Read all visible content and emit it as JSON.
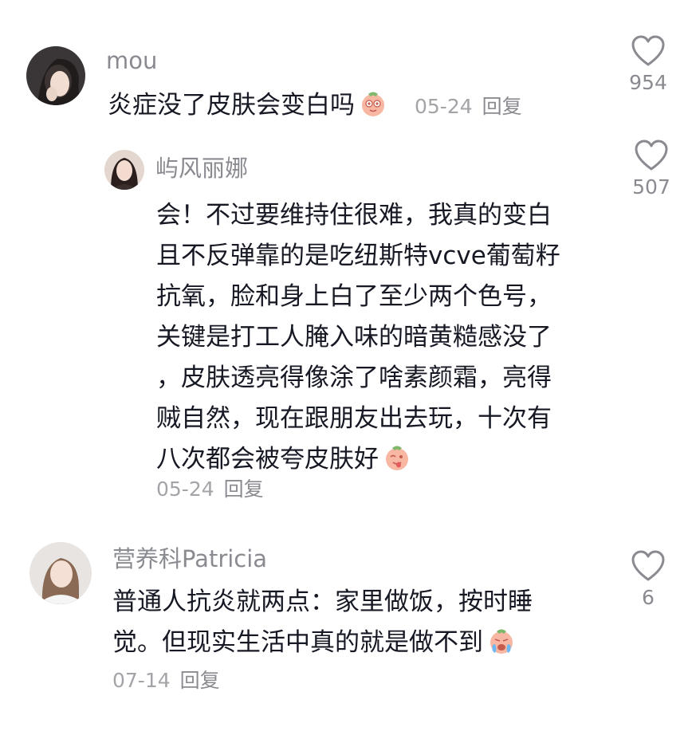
{
  "comments": [
    {
      "username": "mou",
      "text": "炎症没了皮肤会变白吗",
      "emoji": "doge-face-icon",
      "date": "05-24",
      "reply_label": "回复",
      "likes": "954",
      "replies": [
        {
          "username": "屿风丽娜",
          "text_lines": [
            "会！不过要维持住很难，我真的变白",
            "且不反弹靠的是吃纽斯特vcve葡萄籽",
            "抗氧，脸和身上白了至少两个色号，",
            "关键是打工人腌入味的暗黄糙感没了",
            "，皮肤透亮得像涂了啥素颜霜，亮得",
            "贼自然，现在跟朋友出去玩，十次有",
            "八次都会被夸皮肤好"
          ],
          "emoji": "peach-tongue-icon",
          "date": "05-24",
          "reply_label": "回复",
          "likes": "507"
        }
      ]
    },
    {
      "username": "营养科Patricia",
      "text_lines": [
        "普通人抗炎就两点：家里做饭，按时睡",
        "觉。但现实生活中真的就是做不到"
      ],
      "emoji": "crying-face-icon",
      "date": "07-14",
      "reply_label": "回复",
      "likes": "6"
    }
  ]
}
